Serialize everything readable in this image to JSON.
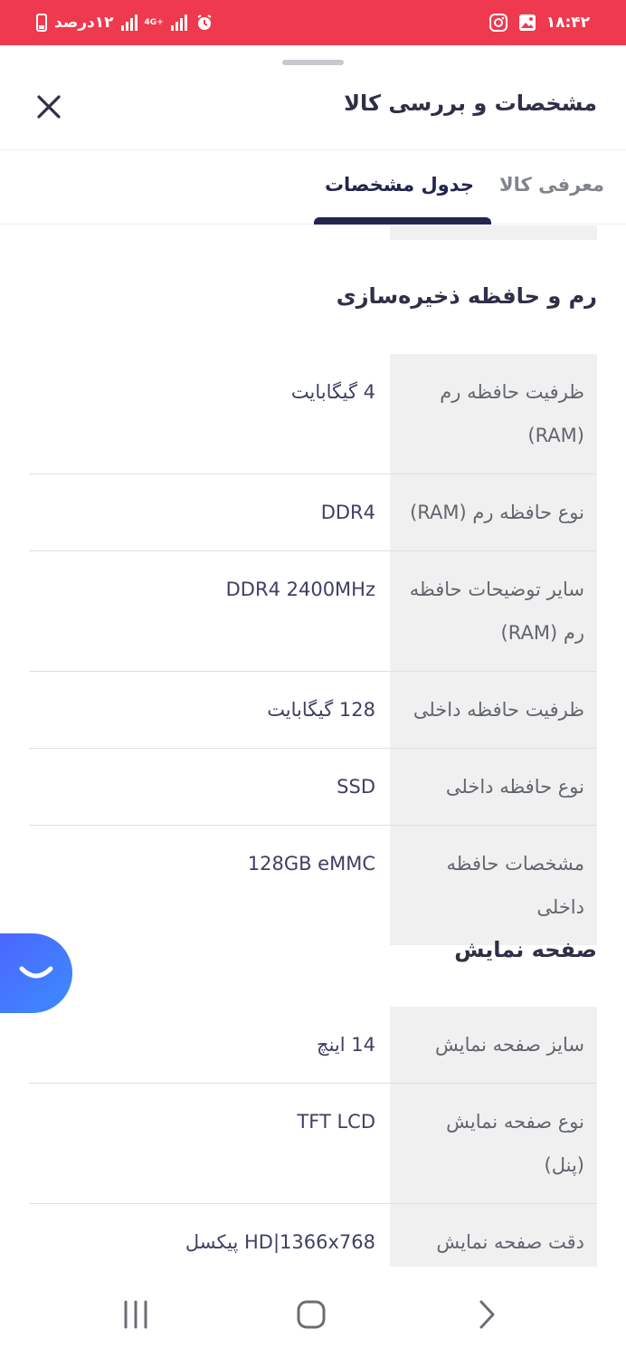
{
  "status_bar": {
    "time": "۱۸:۴۲",
    "battery": "۱۲درصد",
    "network": "4G+"
  },
  "sheet": {
    "title": "مشخصات و بررسی کالا"
  },
  "tabs": [
    {
      "label": "معرفی کالا",
      "active": false
    },
    {
      "label": "جدول مشخصات",
      "active": true
    }
  ],
  "sections": [
    {
      "title": "رم و حافظه ذخیره‌سازی",
      "rows": [
        {
          "key": "ظرفیت حافظه رم (RAM)",
          "value": "4 گیگابایت"
        },
        {
          "key": "نوع حافظه رم (RAM)",
          "value": "DDR4"
        },
        {
          "key": "سایر توضیحات حافظه رم (RAM)",
          "value": "DDR4 2400MHz"
        },
        {
          "key": "ظرفیت حافظه داخلی",
          "value": "128 گیگابایت"
        },
        {
          "key": "نوع حافظه داخلی",
          "value": "SSD"
        },
        {
          "key": "مشخصات حافظه داخلی",
          "value": "128GB eMMC"
        }
      ]
    },
    {
      "title": "صفحه نمایش",
      "rows": [
        {
          "key": "سایز صفحه نمایش",
          "value": "14 اینچ"
        },
        {
          "key": "نوع صفحه نمایش (پنل)",
          "value": "TFT LCD"
        },
        {
          "key": "دقت صفحه نمایش",
          "value": "HD|1366x768 پیکسل"
        }
      ]
    }
  ],
  "colors": {
    "status_bar": "#ef394e",
    "tab_active": "#23254e",
    "key_cell_bg": "#f0f0f1",
    "chat_button": "#4e62ff"
  },
  "icons": {
    "close": "close-icon",
    "chat": "chat-smile-icon",
    "nav_recents": "recents-icon",
    "nav_home": "home-icon",
    "nav_back": "back-icon"
  }
}
